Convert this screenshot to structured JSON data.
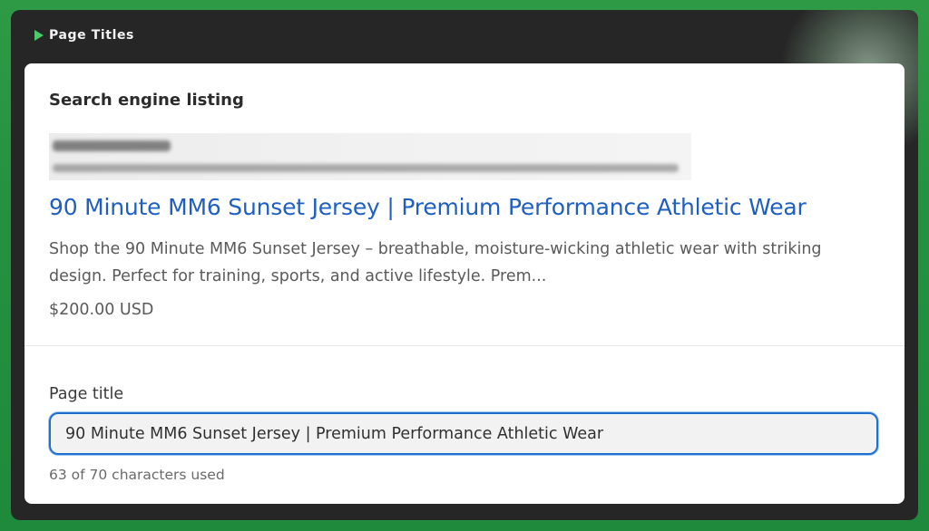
{
  "header": {
    "title": "Page Titles",
    "icon": "play-triangle-icon",
    "accent_color": "#4cc968"
  },
  "search_listing": {
    "section_title": "Search engine listing",
    "title": "90 Minute MM6 Sunset Jersey | Premium Performance Athletic Wear",
    "description": "Shop the 90 Minute MM6 Sunset Jersey – breathable, moisture-wicking athletic wear with striking design. Perfect for training, sports, and active lifestyle. Prem...",
    "price": "$200.00 USD",
    "title_color": "#1f5fc1"
  },
  "page_title_field": {
    "label": "Page title",
    "value": "90 Minute MM6 Sunset Jersey | Premium Performance Athletic Wear",
    "char_count": "63 of 70 characters used",
    "focus_color": "#1f6fd1"
  }
}
